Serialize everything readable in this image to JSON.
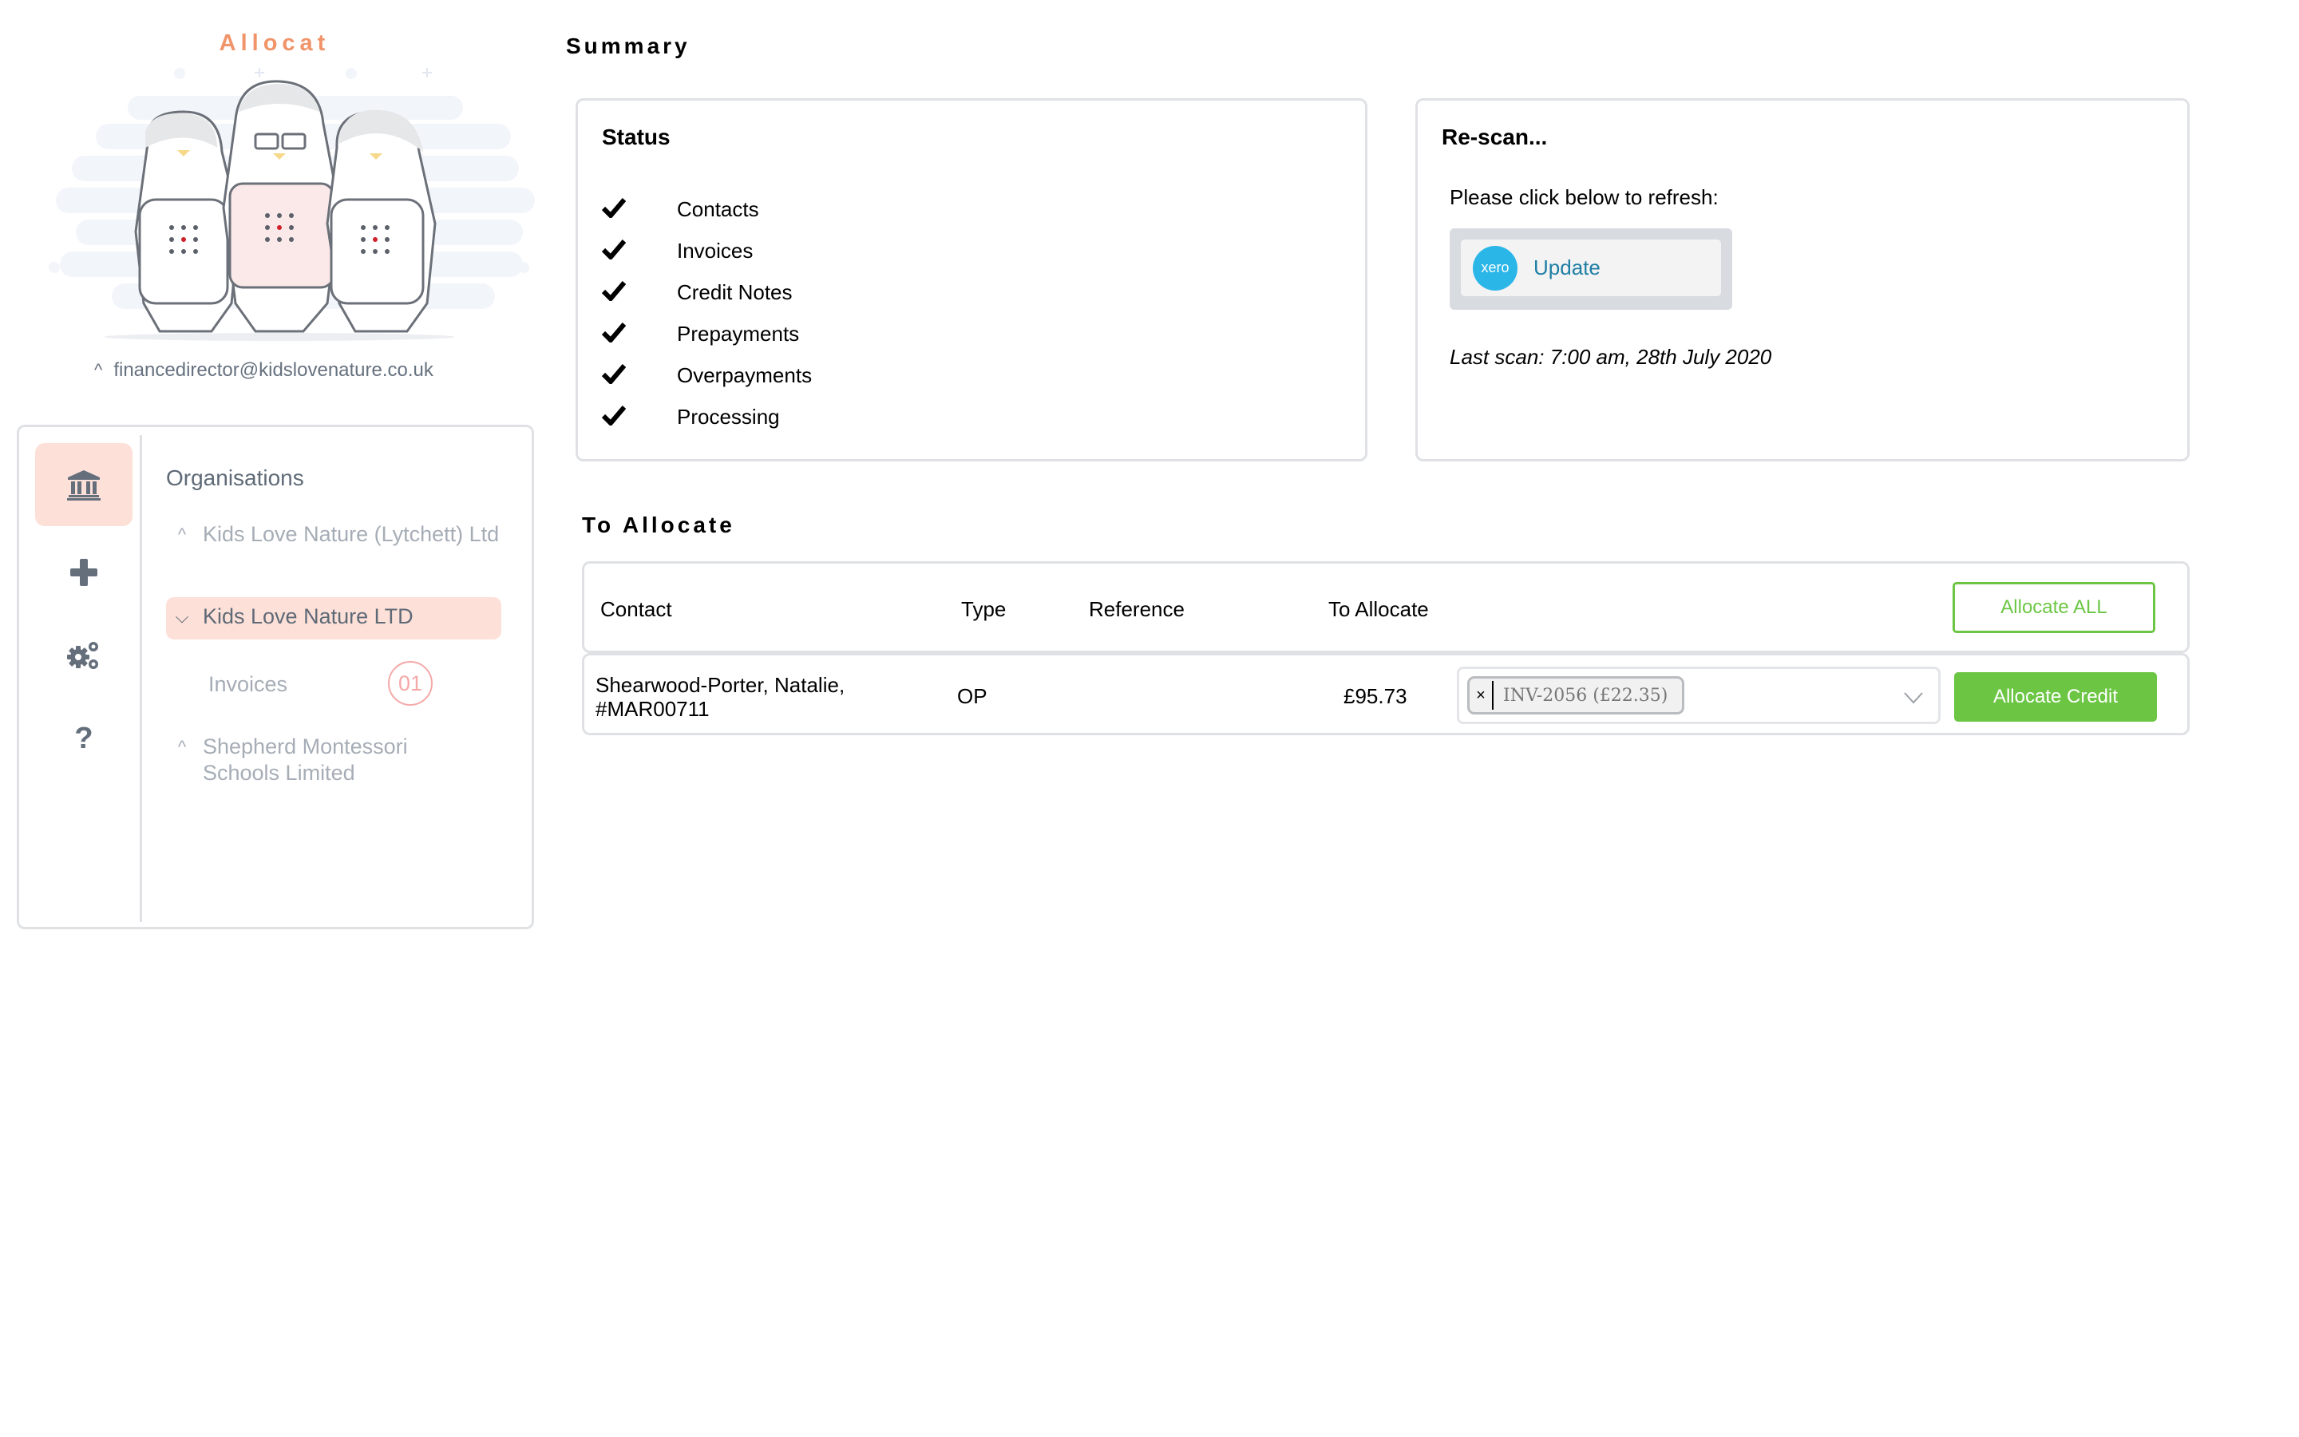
{
  "app": {
    "brand": "Allocat",
    "user_email": "financedirector@kidslovenature.co.uk",
    "accent_color": "#f0946a",
    "success_color": "#6cc644"
  },
  "sidebar": {
    "rail": [
      {
        "name": "organisations",
        "icon": "bank-icon",
        "active": true
      },
      {
        "name": "add",
        "icon": "plus-icon",
        "active": false
      },
      {
        "name": "settings",
        "icon": "cogs-icon",
        "active": false
      },
      {
        "name": "help",
        "icon": "question-icon",
        "active": false
      }
    ],
    "title": "Organisations",
    "organisations": [
      {
        "label": "Kids Love Nature (Lytchett) Ltd",
        "expanded": false
      },
      {
        "label": "Kids Love Nature LTD",
        "expanded": true,
        "active": true
      },
      {
        "label": "Shepherd Montessori Schools Limited",
        "expanded": false
      }
    ],
    "sub_items": [
      {
        "label": "Invoices",
        "badge": "01"
      }
    ]
  },
  "summary": {
    "title": "Summary",
    "status": {
      "title": "Status",
      "items": [
        {
          "label": "Contacts",
          "done": true
        },
        {
          "label": "Invoices",
          "done": true
        },
        {
          "label": "Credit Notes",
          "done": true
        },
        {
          "label": "Prepayments",
          "done": true
        },
        {
          "label": "Overpayments",
          "done": true
        },
        {
          "label": "Processing",
          "done": true
        }
      ]
    },
    "rescan": {
      "title": "Re-scan...",
      "prompt": "Please click below to refresh:",
      "logo_text": "xero",
      "button_label": "Update",
      "last_scan": "Last scan: 7:00 am, 28th July 2020"
    }
  },
  "to_allocate": {
    "title": "To Allocate",
    "columns": [
      "Contact",
      "Type",
      "Reference",
      "To Allocate"
    ],
    "allocate_all_label": "Allocate ALL",
    "rows": [
      {
        "contact_line1": "Shearwood-Porter, Natalie,",
        "contact_line2": "#MAR00711",
        "type": "OP",
        "reference": "",
        "amount": "£95.73",
        "selected_invoice": "INV-2056 (£22.35)",
        "remove_label": "×",
        "action_label": "Allocate Credit"
      }
    ]
  }
}
